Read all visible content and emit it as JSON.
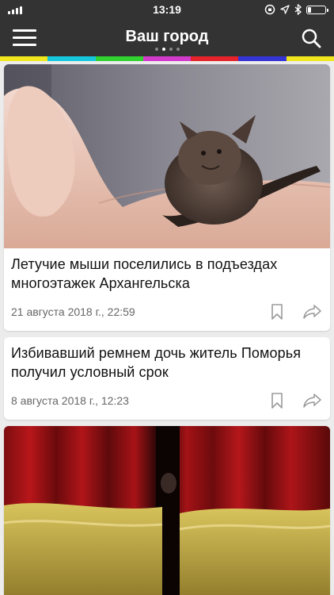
{
  "status_bar": {
    "time": "13:19",
    "battery_level": 0.2,
    "icons": [
      "signal-icon",
      "rotation-lock-icon",
      "location-icon",
      "bluetooth-icon",
      "battery-icon"
    ]
  },
  "header": {
    "title": "Ваш город",
    "menu_icon": "hamburger-menu-icon",
    "search_icon": "search-icon",
    "page_count": 4,
    "active_page": 2
  },
  "color_stripe": [
    "#f0e81c",
    "#16c7de",
    "#32d230",
    "#d23acb",
    "#e6232a",
    "#3535d6",
    "#f0e81c"
  ],
  "articles": [
    {
      "title": "Летучие мыши поселились в подъездах многоэтажек Архангельска",
      "date": "21 августа 2018 г., 22:59",
      "has_image": true,
      "image": "bat-on-hand-photo"
    },
    {
      "title": "Избивавший ремнем дочь житель Поморья получил условный срок",
      "date": "8 августа 2018 г., 12:23",
      "has_image": false
    },
    {
      "title": "",
      "date": "",
      "has_image": true,
      "image": "theater-curtain-photo"
    }
  ],
  "colors": {
    "bar_background": "#333333",
    "page_background": "#ececec",
    "card_background": "#ffffff",
    "date_text": "#666666",
    "action_icon": "#9a9a9a"
  }
}
